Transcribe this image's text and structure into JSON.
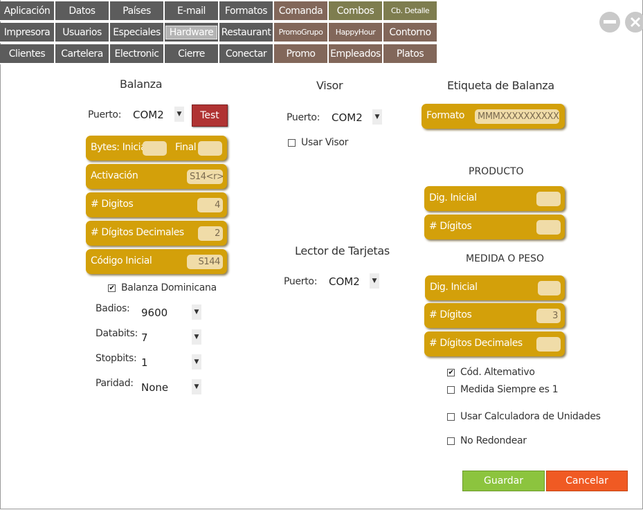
{
  "tabs": {
    "row1": [
      "Aplicación",
      "Datos",
      "Países",
      "E-mail",
      "Formatos",
      "Comanda",
      "Combos",
      "Cb. Detalle"
    ],
    "row2": [
      "Impresora",
      "Usuarios",
      "Especiales",
      "Hardware",
      "Restaurant",
      "PromoGrupo",
      "HappyHour",
      "Contorno"
    ],
    "row3": [
      "Clientes",
      "Cartelera",
      "Electronic",
      "Cierre",
      "Conectar",
      "Promo",
      "Empleados",
      "Platos"
    ]
  },
  "window": {
    "minimize": "—",
    "close": "✕"
  },
  "balanza": {
    "title": "Balanza",
    "puerto_label": "Puerto:",
    "puerto_value": "COM2",
    "test_label": "Test",
    "bytes_label": "Bytes: Inicial",
    "final_label": "Final",
    "bytes_inicial": "",
    "bytes_final": "",
    "activacion_label": "Activación",
    "activacion_value": "S14<r>",
    "digitos_label": "# Digitos",
    "digitos_value": "4",
    "decimales_label": "# Dígitos Decimales",
    "decimales_value": "2",
    "codigo_label": "Código Inicial",
    "codigo_value": "S144",
    "dominicana_label": "Balanza Dominicana",
    "dominicana_checked": true,
    "badios_label": "Badios:",
    "badios_value": "9600",
    "databits_label": "Databits:",
    "databits_value": "7",
    "stopbits_label": "Stopbits:",
    "stopbits_value": "1",
    "paridad_label": "Paridad:",
    "paridad_value": "None"
  },
  "visor": {
    "title": "Visor",
    "puerto_label": "Puerto:",
    "puerto_value": "COM2",
    "usar_label": "Usar Visor",
    "usar_checked": false
  },
  "lector": {
    "title": "Lector de Tarjetas",
    "puerto_label": "Puerto:",
    "puerto_value": "COM2"
  },
  "etiqueta": {
    "title": "Etiqueta de Balanza",
    "formato_label": "Formato",
    "formato_value": "MMMXXXXXXXXXXX",
    "producto_title": "PRODUCTO",
    "prod_dig_inicial_label": "Dig. Inicial",
    "prod_dig_inicial_value": "",
    "prod_digitos_label": "# Dígitos",
    "prod_digitos_value": "",
    "medida_title": "MEDIDA O PESO",
    "med_dig_inicial_label": "Dig. Inicial",
    "med_dig_inicial_value": "",
    "med_digitos_label": "# Dígitos",
    "med_digitos_value": "3",
    "med_decimales_label": "# Dígitos Decimales",
    "med_decimales_value": "",
    "cod_alt_label": "Cód. Altemativo",
    "cod_alt_checked": true,
    "medida_siempre_label": "Medida Siempre es 1",
    "medida_siempre_checked": false,
    "calculadora_label": "Usar Calculadora de Unidades",
    "calculadora_checked": false,
    "no_redondear_label": "No Redondear",
    "no_redondear_checked": false
  },
  "actions": {
    "guardar": "Guardar",
    "cancelar": "Cancelar"
  },
  "colors": {
    "gold": "#d3a00a",
    "gray_tab": "#5c5c5c",
    "brown_tab": "#82675a",
    "olive_tab": "#7e7d4f",
    "test": "#b03333",
    "guardar": "#8cc43e",
    "cancelar": "#f05a23"
  }
}
